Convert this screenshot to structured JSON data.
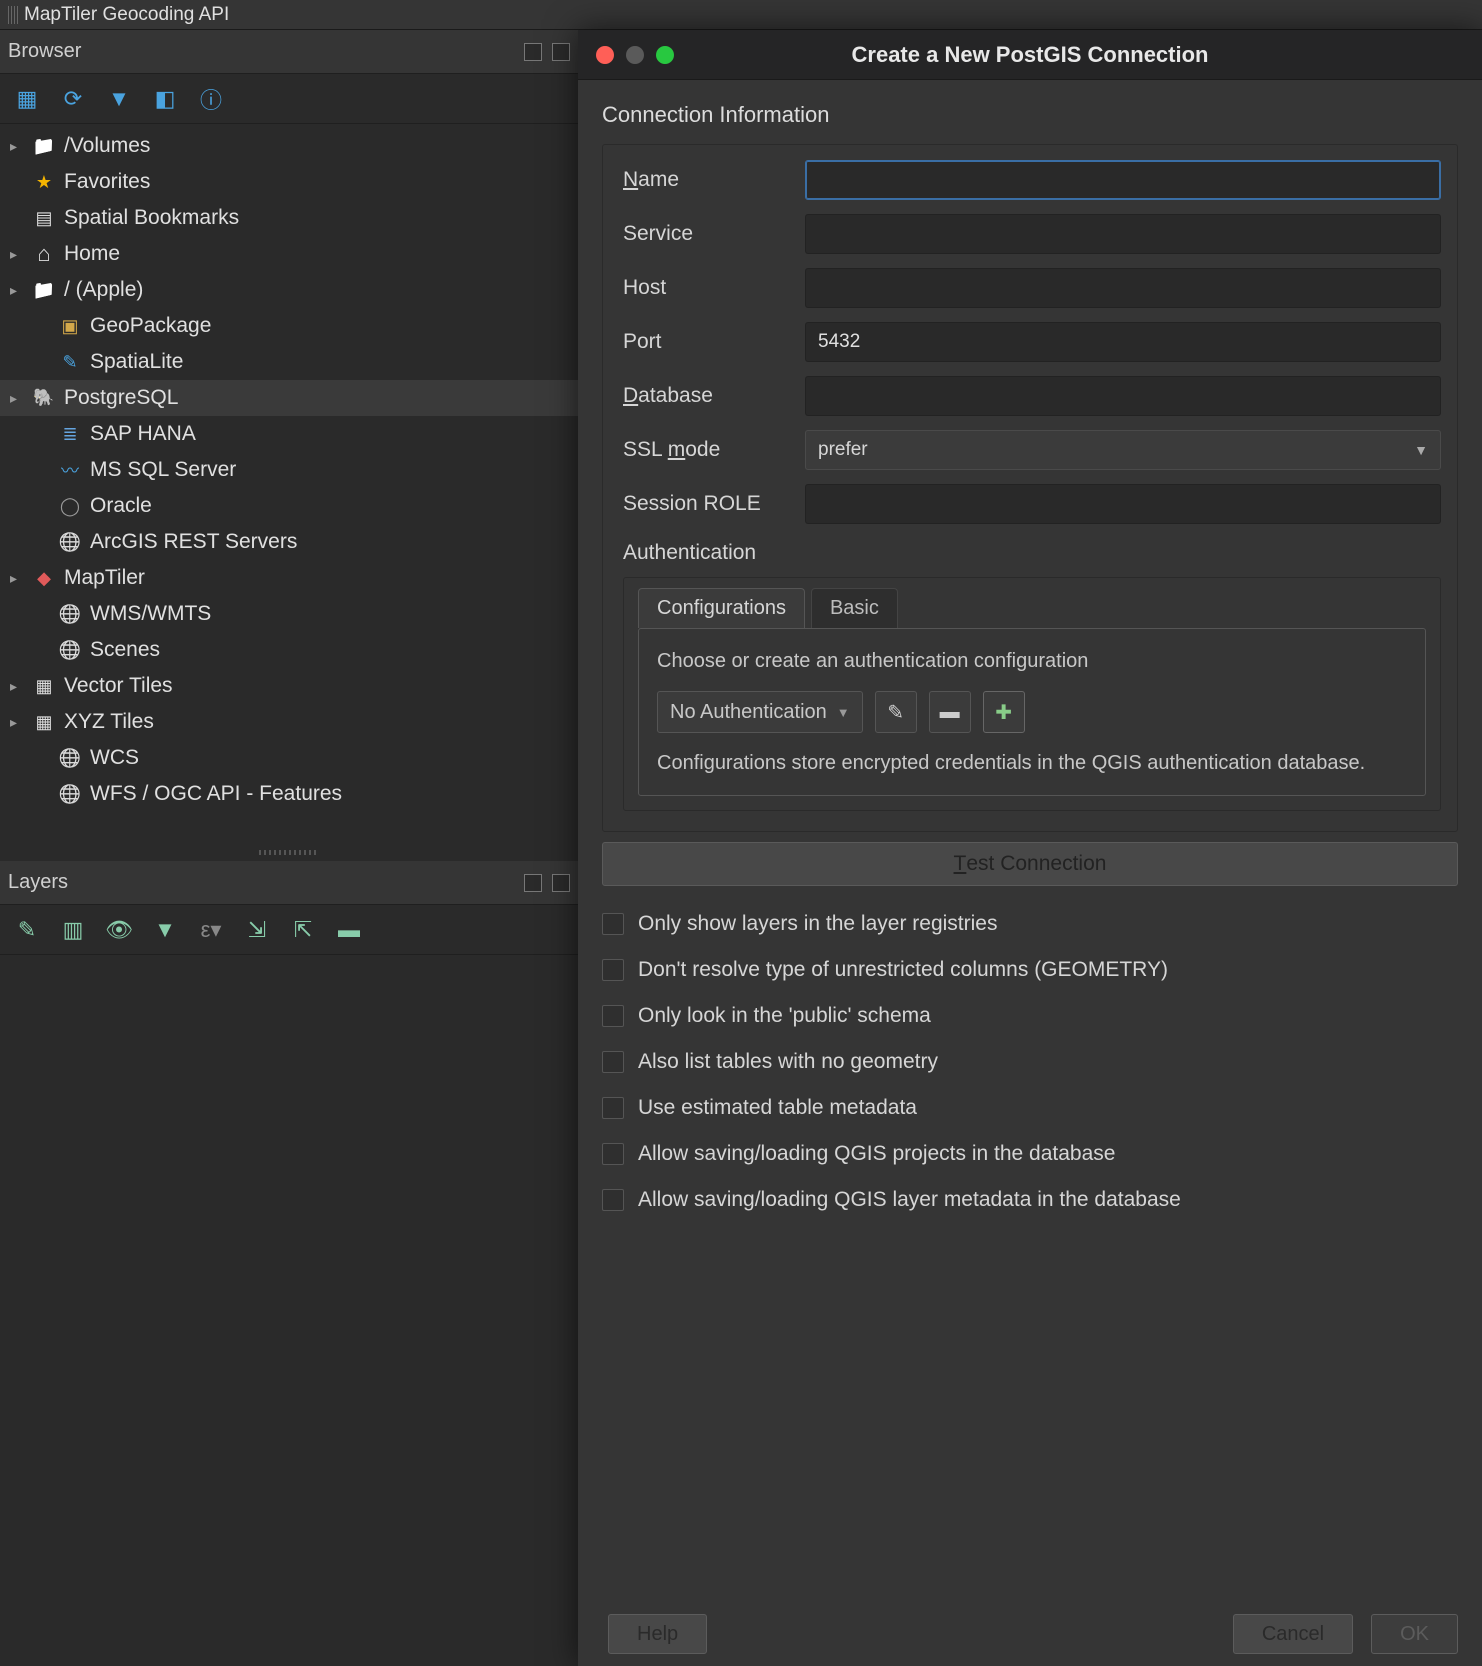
{
  "top_bar": {
    "title": "MapTiler Geocoding API"
  },
  "browser": {
    "title": "Browser",
    "items": [
      {
        "label": "/Volumes",
        "icon": "ic-folder",
        "arrow": "▸",
        "level": 1
      },
      {
        "label": "Favorites",
        "icon": "ic-star",
        "arrow": "",
        "level": 1
      },
      {
        "label": "Spatial Bookmarks",
        "icon": "ic-book",
        "arrow": "",
        "level": 1
      },
      {
        "label": "Home",
        "icon": "ic-home",
        "arrow": "▸",
        "level": 1
      },
      {
        "label": "/ (Apple)",
        "icon": "ic-folder",
        "arrow": "▸",
        "level": 1
      },
      {
        "label": "GeoPackage",
        "icon": "ic-box",
        "arrow": "",
        "level": 2
      },
      {
        "label": "SpatiaLite",
        "icon": "ic-feather",
        "arrow": "",
        "level": 2
      },
      {
        "label": "PostgreSQL",
        "icon": "ic-pg",
        "arrow": "▸",
        "level": 1,
        "selected": true
      },
      {
        "label": "SAP HANA",
        "icon": "ic-db",
        "arrow": "",
        "level": 2
      },
      {
        "label": "MS SQL Server",
        "icon": "ic-wave",
        "arrow": "",
        "level": 2
      },
      {
        "label": "Oracle",
        "icon": "ic-oval",
        "arrow": "",
        "level": 2
      },
      {
        "label": "ArcGIS REST Servers",
        "icon": "ic-globe",
        "arrow": "",
        "level": 2
      },
      {
        "label": "MapTiler",
        "icon": "ic-mt",
        "arrow": "▸",
        "level": 1
      },
      {
        "label": "WMS/WMTS",
        "icon": "ic-globe",
        "arrow": "",
        "level": 2
      },
      {
        "label": "Scenes",
        "icon": "ic-globe",
        "arrow": "",
        "level": 2
      },
      {
        "label": "Vector Tiles",
        "icon": "ic-grid",
        "arrow": "▸",
        "level": 1
      },
      {
        "label": "XYZ Tiles",
        "icon": "ic-grid",
        "arrow": "▸",
        "level": 1
      },
      {
        "label": "WCS",
        "icon": "ic-globe",
        "arrow": "",
        "level": 2
      },
      {
        "label": "WFS / OGC API - Features",
        "icon": "ic-globe",
        "arrow": "",
        "level": 2
      }
    ]
  },
  "layers": {
    "title": "Layers"
  },
  "dialog": {
    "title": "Create a New PostGIS Connection",
    "group_title": "Connection Information",
    "fields": {
      "name": {
        "label_pre": "",
        "label_ul": "N",
        "label_post": "ame",
        "value": ""
      },
      "service": {
        "label": "Service",
        "value": ""
      },
      "host": {
        "label": "Host",
        "value": ""
      },
      "port": {
        "label": "Port",
        "value": "5432"
      },
      "database": {
        "label_pre": "",
        "label_ul": "D",
        "label_post": "atabase",
        "value": ""
      },
      "sslmode": {
        "label_pre": "SSL ",
        "label_ul": "m",
        "label_post": "ode",
        "value": "prefer"
      },
      "session_role": {
        "label": "Session ROLE",
        "value": ""
      }
    },
    "auth": {
      "label": "Authentication",
      "tabs": {
        "config": "Configurations",
        "basic": "Basic"
      },
      "choose_text": "Choose or create an authentication configuration",
      "select_value": "No Authentication",
      "desc": "Configurations store encrypted credentials in the QGIS authentication database."
    },
    "test_btn_pre": "",
    "test_btn_ul": "T",
    "test_btn_post": "est Connection",
    "checks": [
      "Only show layers in the layer registries",
      "Don't resolve type of unrestricted columns (GEOMETRY)",
      "Only look in the 'public' schema",
      "Also list tables with no geometry",
      "Use estimated table metadata",
      "Allow saving/loading QGIS projects in the database",
      "Allow saving/loading QGIS layer metadata in the database"
    ],
    "buttons": {
      "help": "Help",
      "cancel": "Cancel",
      "ok": "OK"
    }
  }
}
